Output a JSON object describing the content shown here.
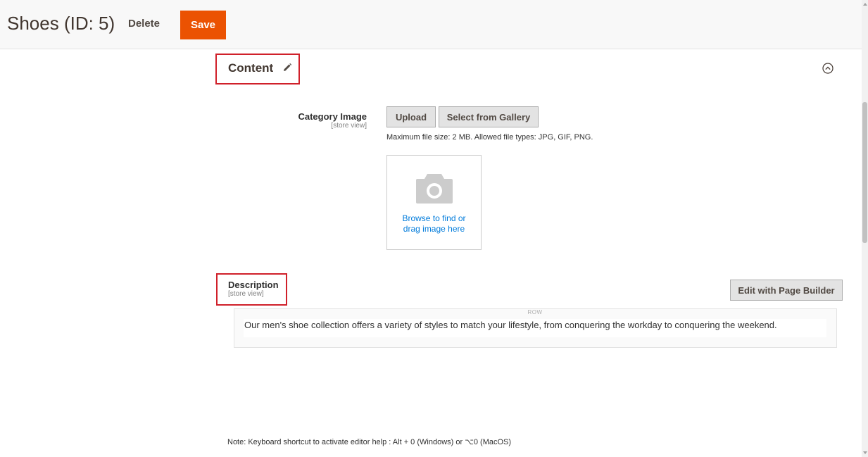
{
  "header": {
    "title": "Shoes (ID: 5)",
    "delete_label": "Delete",
    "save_label": "Save"
  },
  "content_section": {
    "title": "Content",
    "edit_icon": "pencil-icon",
    "collapse_icon": "chevron-up-circle-icon"
  },
  "category_image": {
    "label": "Category Image",
    "scope": "[store view]",
    "upload_label": "Upload",
    "gallery_label": "Select from Gallery",
    "file_note": "Maximum file size: 2 MB. Allowed file types: JPG, GIF, PNG.",
    "dropzone_line1": "Browse to find or",
    "dropzone_line2": "drag image here",
    "dropzone_icon": "camera-icon"
  },
  "description": {
    "label": "Description",
    "scope": "[store view]",
    "page_builder_label": "Edit with Page Builder",
    "row_label": "ROW",
    "text": "Our men's shoe collection offers a variety of styles to match your lifestyle, from conquering the workday to conquering the weekend."
  },
  "editor_note": "Note: Keyboard shortcut to activate editor help : Alt + 0 (Windows) or ⌥0 (MacOS)",
  "colors": {
    "accent": "#eb5202",
    "highlight_border": "#d0202a",
    "link": "#007bdb"
  }
}
